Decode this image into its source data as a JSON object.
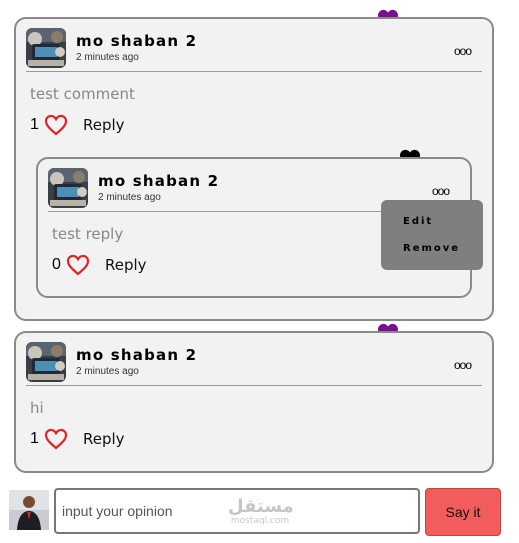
{
  "colors": {
    "accent_heart": "#7a0f8f",
    "like_heart": "#e02424",
    "send_button": "#f25c5c",
    "menu_bg": "#7f7f7f",
    "card_bg": "#f2f2f2"
  },
  "icons": {
    "top_heart": "heart-filled-icon",
    "like": "heart-outline-icon",
    "more": "more-options-icon"
  },
  "comments": [
    {
      "author": "mo shaban 2",
      "time": "2 minutes ago",
      "more": "ooo",
      "text": "test comment",
      "likes": "1",
      "reply_label": "Reply",
      "replies": [
        {
          "author": "mo shaban 2",
          "time": "2 minutes ago",
          "more": "ooo",
          "text": "test reply",
          "likes": "0",
          "reply_label": "Reply"
        }
      ]
    },
    {
      "author": "mo shaban 2",
      "time": "2 minutes ago",
      "more": "ooo",
      "text": "hi",
      "likes": "1",
      "reply_label": "Reply",
      "replies": []
    }
  ],
  "context_menu": {
    "edit": "Edit",
    "remove": "Remove"
  },
  "composer": {
    "placeholder": "input your opinion",
    "send_label": "Say it"
  },
  "watermark": {
    "arabic": "مستقل",
    "latin": "mostaql.com"
  }
}
